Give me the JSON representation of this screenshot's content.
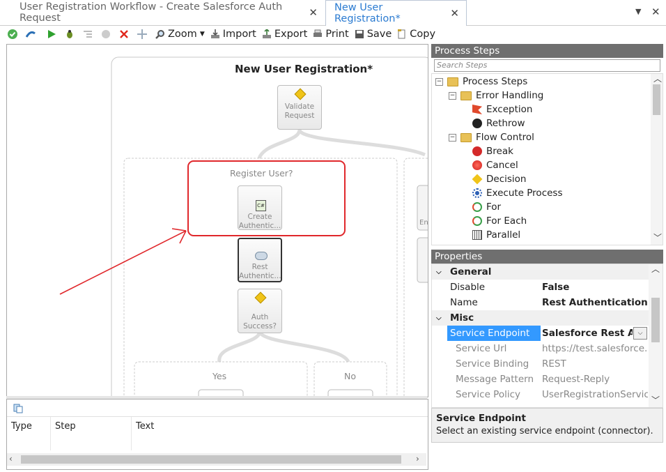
{
  "tabs": [
    {
      "label": "User Registration Workflow - Create Salesforce Auth Request",
      "active": false
    },
    {
      "label": "New User Registration*",
      "active": true
    }
  ],
  "toolbar": {
    "zoom": "Zoom",
    "import": "Import",
    "export": "Export",
    "print": "Print",
    "save": "Save",
    "copy": "Copy"
  },
  "diagram": {
    "title": "New User Registration*",
    "nodes": {
      "validate": "Validate Request",
      "register_scope": "Register User?",
      "create_auth": "Create Authentic...",
      "rest_auth": "Rest Authentic...",
      "auth_success": "Auth Success?",
      "yes": "Yes",
      "no": "No",
      "partial": "En"
    }
  },
  "bottom": {
    "columns": [
      "Type",
      "Step",
      "Text"
    ]
  },
  "process_steps": {
    "header": "Process Steps",
    "search_placeholder": "Search Steps",
    "tree": {
      "root": "Process Steps",
      "error_handling": "Error Handling",
      "exception": "Exception",
      "rethrow": "Rethrow",
      "flow_control": "Flow Control",
      "break": "Break",
      "cancel": "Cancel",
      "decision": "Decision",
      "execute_process": "Execute Process",
      "for": "For",
      "for_each": "For Each",
      "parallel": "Parallel"
    }
  },
  "properties": {
    "header": "Properties",
    "general": "General",
    "disable_name": "Disable",
    "disable_val": "False",
    "name_name": "Name",
    "name_val": "Rest Authentication Co",
    "misc": "Misc",
    "endpoint_name": "Service Endpoint",
    "endpoint_val": "Salesforce Rest Auth",
    "url_name": "Service Url",
    "url_val": "https://test.salesforce.cor",
    "binding_name": "Service Binding",
    "binding_val": "REST",
    "pattern_name": "Message Pattern",
    "pattern_val": "Request-Reply",
    "policy_name": "Service Policy",
    "policy_val": "UserRegistrationServiceP",
    "desc_title": "Service Endpoint",
    "desc_text": "Select an existing service endpoint (connector)."
  }
}
